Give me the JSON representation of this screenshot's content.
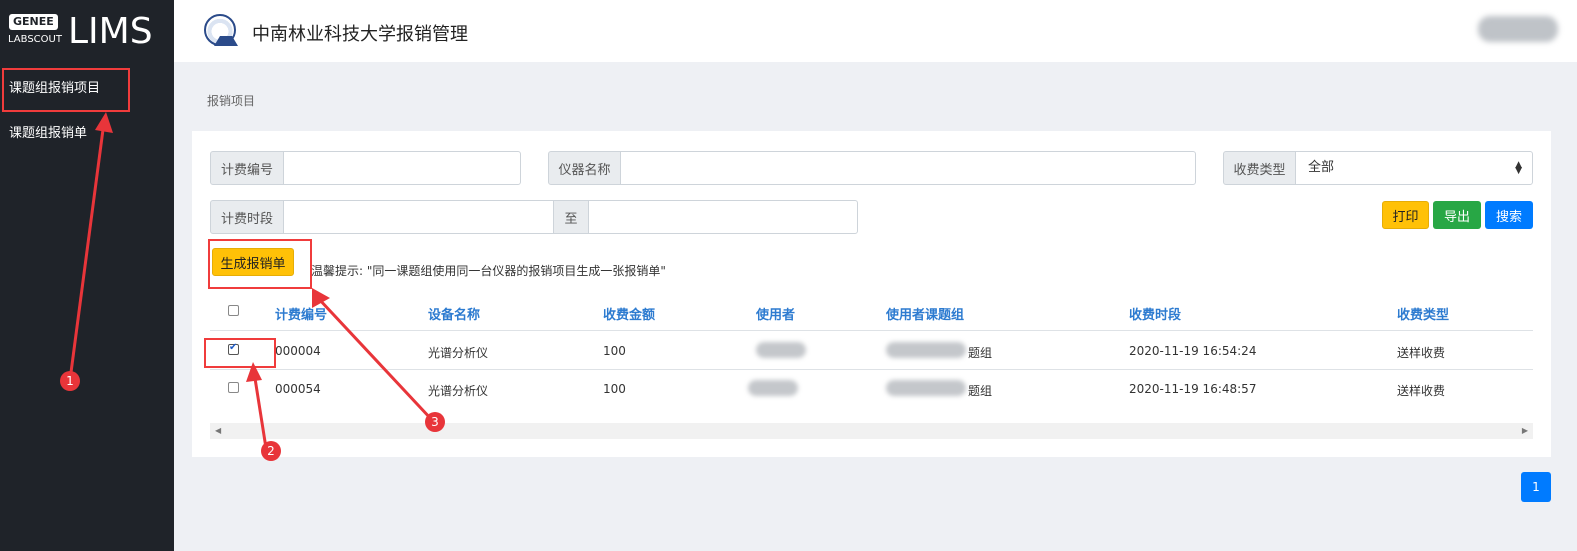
{
  "brand": {
    "badge": "GENEE",
    "sub": "LABSCOUT",
    "name": "LIMS"
  },
  "sidebar": {
    "items": [
      {
        "label": "课题组报销项目"
      },
      {
        "label": "课题组报销单"
      }
    ]
  },
  "header": {
    "title": "中南林业科技大学报销管理"
  },
  "breadcrumb": "报销项目",
  "filters": {
    "billing_no_label": "计费编号",
    "billing_no_value": "",
    "instrument_label": "仪器名称",
    "instrument_value": "",
    "fee_type_label": "收费类型",
    "fee_type_selected": "全部",
    "period_label": "计费时段",
    "period_to": "至",
    "period_start": "",
    "period_end": ""
  },
  "buttons": {
    "print": "打印",
    "export": "导出",
    "search": "搜索",
    "generate": "生成报销单"
  },
  "tip": "温馨提示: \"同一课题组使用同一台仪器的报销项目生成一张报销单\"",
  "table": {
    "headers": [
      "计费编号",
      "设备名称",
      "收费金额",
      "使用者",
      "使用者课题组",
      "收费时段",
      "收费类型"
    ],
    "rows": [
      {
        "checked": true,
        "no": "000004",
        "device": "光谱分析仪",
        "amount": "100",
        "time": "2020-11-19 16:54:24",
        "fee_type": "送样收费",
        "group_suffix": "题组"
      },
      {
        "checked": false,
        "no": "000054",
        "device": "光谱分析仪",
        "amount": "100",
        "time": "2020-11-19 16:48:57",
        "fee_type": "送样收费",
        "group_suffix": "题组"
      }
    ]
  },
  "pagination": {
    "current": "1"
  },
  "annotations": {
    "markers": [
      "1",
      "2",
      "3"
    ],
    "color": "#e8353a"
  }
}
